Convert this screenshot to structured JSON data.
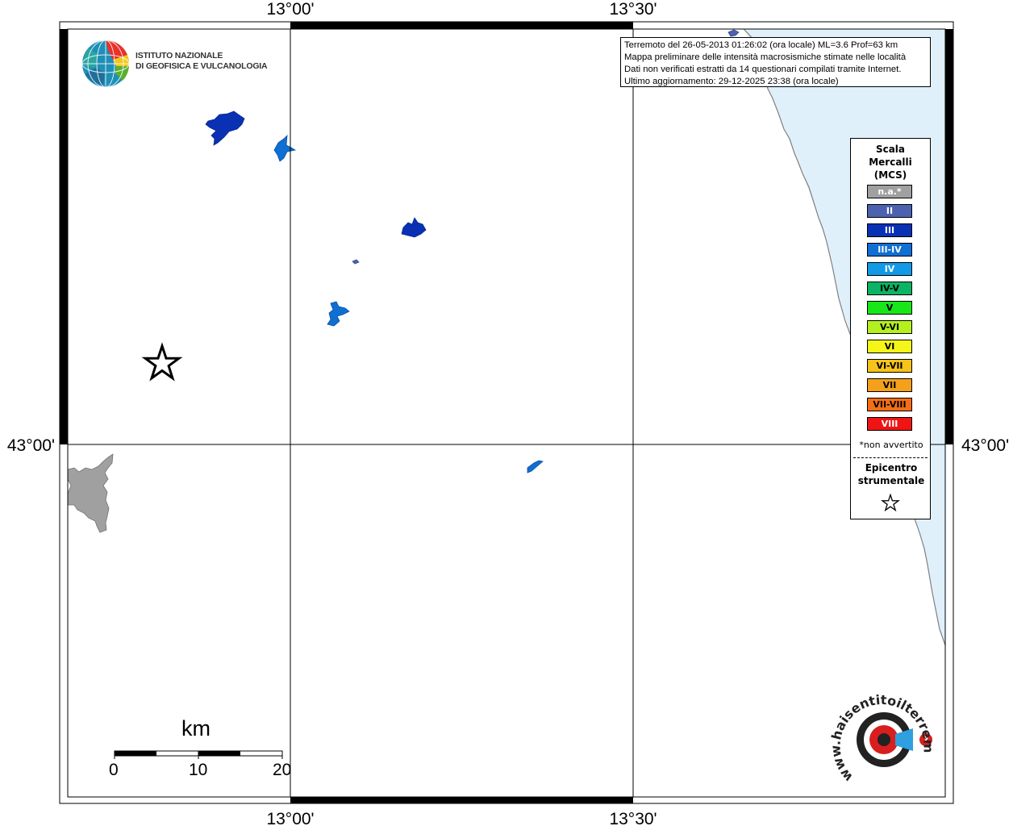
{
  "map": {
    "coord_labels": {
      "lon_left": "13°00'",
      "lon_right": "13°30'",
      "lat_mid": "43°00'"
    },
    "colors": {
      "sea": "#dff0fb",
      "coast": "#808080",
      "grid": "#000000",
      "intensity_ii": "#4c62b0",
      "intensity_iii": "#0a30b4",
      "intensity_iii_iv": "#0f6fd2",
      "intensity_na": "#a0a0a0"
    }
  },
  "info": {
    "line1": "Terremoto del 26-05-2013 01:26:02 (ora locale) ML=3.6 Prof=63 km",
    "line2": "Mappa preliminare delle intensità macrosismiche stimate nelle località",
    "line3": "Dati non verificati estratti da 14 questionari compilati tramite Internet.",
    "line4": "Ultimo aggiornamento: 29-12-2025 23:38 (ora locale)"
  },
  "legend": {
    "title_line1": "Scala",
    "title_line2": "Mercalli",
    "title_line3": "(MCS)",
    "items": [
      {
        "label": "n.a.*",
        "color": "#a0a0a0"
      },
      {
        "label": "II",
        "color": "#4c62b0"
      },
      {
        "label": "III",
        "color": "#0a30b4"
      },
      {
        "label": "III-IV",
        "color": "#0f6fd2"
      },
      {
        "label": "IV",
        "color": "#129ae6"
      },
      {
        "label": "IV-V",
        "color": "#0bb364"
      },
      {
        "label": "V",
        "color": "#19e619"
      },
      {
        "label": "V-VI",
        "color": "#b4f01e"
      },
      {
        "label": "VI",
        "color": "#f5f51a"
      },
      {
        "label": "VI-VII",
        "color": "#f5c31a"
      },
      {
        "label": "VII",
        "color": "#f5a01a"
      },
      {
        "label": "VII-VIII",
        "color": "#f56e14"
      },
      {
        "label": "VIII",
        "color": "#f01414"
      }
    ],
    "note": "*non avvertito",
    "epicenter_line1": "Epicentro",
    "epicenter_line2": "strumentale"
  },
  "logo": {
    "line1": "ISTITUTO NAZIONALE",
    "line2": "DI GEOFISICA E VULCANOLOGIA"
  },
  "scalebar": {
    "title": "km",
    "ticks": [
      "0",
      "10",
      "20"
    ]
  },
  "hsi_logo": {
    "text": "www.haisentitoilterremoto.it"
  }
}
